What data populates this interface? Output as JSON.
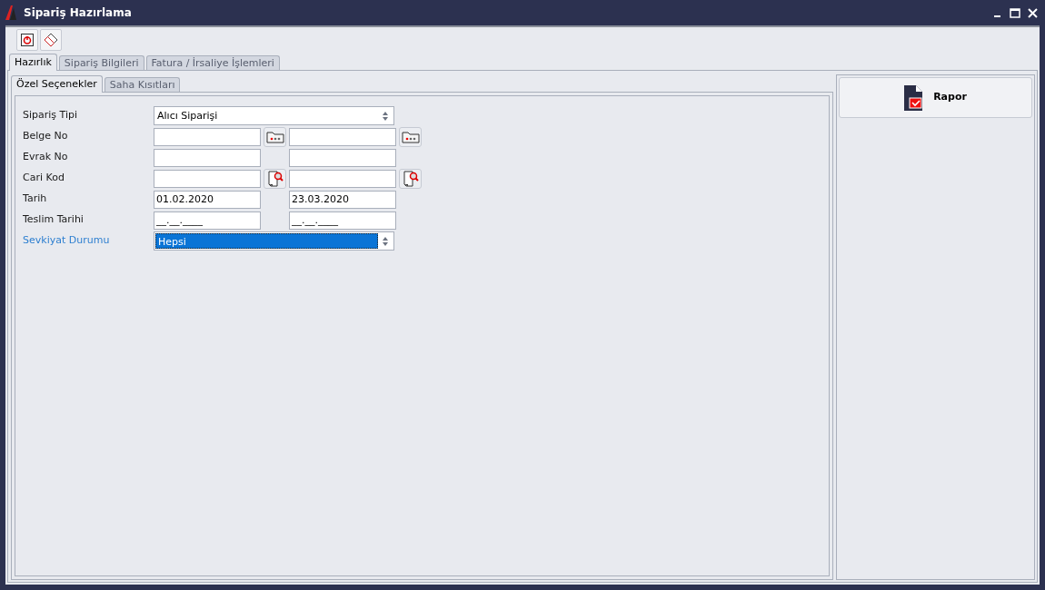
{
  "window": {
    "title": "Sipariş Hazırlama"
  },
  "tabs": [
    {
      "label": "Hazırlık",
      "selected": true
    },
    {
      "label": "Sipariş Bilgileri",
      "selected": false
    },
    {
      "label": "Fatura / İrsaliye İşlemleri",
      "selected": false
    }
  ],
  "subtabs": [
    {
      "label": "Özel Seçenekler",
      "selected": true
    },
    {
      "label": "Saha Kısıtları",
      "selected": false
    }
  ],
  "form": [
    {
      "label": "Sipariş Tipi",
      "kind": "select",
      "focused": false,
      "value": "Alıcı Siparişi"
    },
    {
      "label": "Belge No",
      "kind": "pair",
      "focused": false,
      "fields": [
        {
          "kind": "browse"
        },
        {
          "kind": "browse"
        }
      ]
    },
    {
      "label": "Evrak No",
      "kind": "pair",
      "focused": false,
      "fields": [
        {
          "kind": "plain"
        },
        {
          "kind": "plain"
        }
      ]
    },
    {
      "label": "Cari Kod",
      "kind": "pair",
      "focused": false,
      "fields": [
        {
          "kind": "lookup"
        },
        {
          "kind": "lookup"
        }
      ]
    },
    {
      "label": "Tarih",
      "kind": "pair",
      "focused": false,
      "fields": [
        {
          "kind": "plain",
          "value": "01.02.2020"
        },
        {
          "kind": "plain",
          "value": "23.03.2020"
        }
      ]
    },
    {
      "label": "Teslim Tarihi",
      "kind": "pair",
      "focused": false,
      "fields": [
        {
          "kind": "plain",
          "value": "__.__.____"
        },
        {
          "kind": "plain",
          "value": "__.__.____"
        }
      ]
    },
    {
      "label": "Sevkiyat Durumu",
      "kind": "select",
      "focused": true,
      "value": "Hepsi"
    }
  ],
  "report_button": {
    "label": "Rapor"
  }
}
